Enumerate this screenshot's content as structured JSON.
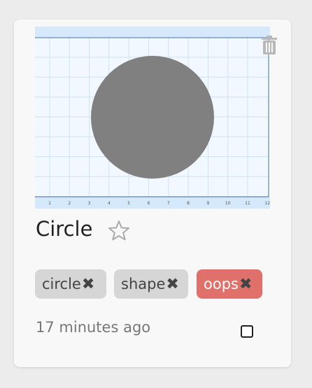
{
  "card": {
    "title": "Circle",
    "timestamp": "17 minutes ago",
    "favorited": false,
    "selected": false,
    "icons": {
      "delete": "trash-icon",
      "favorite": "star-outline-icon",
      "remove_tag": "x-icon"
    },
    "thumbnail": {
      "ruler_labels": [
        "1",
        "2",
        "3",
        "4",
        "5",
        "6",
        "7",
        "8",
        "9",
        "10",
        "11",
        "12"
      ],
      "shape_color": "#808080",
      "grid_color": "#cfe2f3",
      "background_color": "#f2f8ff"
    },
    "tags": [
      {
        "label": "circle",
        "remove_label": "✖",
        "style": "normal"
      },
      {
        "label": "shape",
        "remove_label": "✖",
        "style": "normal"
      },
      {
        "label": "oops",
        "remove_label": "✖",
        "style": "error"
      }
    ],
    "colors": {
      "tag_bg": "#d6d6d6",
      "tag_error_bg": "#e0706a",
      "card_bg": "#f8f8f8"
    }
  }
}
